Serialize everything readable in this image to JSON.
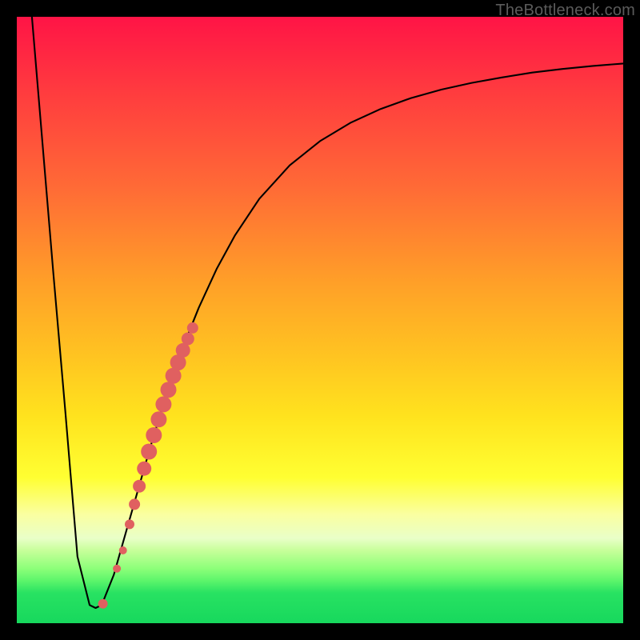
{
  "watermark": "TheBottleneck.com",
  "chart_data": {
    "type": "line",
    "title": "",
    "xlabel": "",
    "ylabel": "",
    "xlim": [
      0,
      100
    ],
    "ylim": [
      0,
      100
    ],
    "curve": {
      "name": "bottleneck-curve",
      "x": [
        2.5,
        4,
        6,
        8,
        10,
        12,
        13,
        14,
        16,
        18,
        20,
        22,
        24,
        26,
        28,
        30,
        33,
        36,
        40,
        45,
        50,
        55,
        60,
        65,
        70,
        75,
        80,
        85,
        90,
        95,
        100
      ],
      "y": [
        100,
        82,
        58,
        35,
        11,
        3,
        2.5,
        3,
        8,
        15,
        22,
        29,
        35.5,
        41.5,
        47,
        52,
        58.5,
        64,
        70,
        75.5,
        79.5,
        82.5,
        84.8,
        86.6,
        88,
        89.1,
        90,
        90.8,
        91.4,
        91.9,
        92.3
      ]
    },
    "marker_cluster": {
      "name": "highlighted-region",
      "color": "#e06060",
      "points": [
        {
          "x": 14.2,
          "y": 3.2,
          "r": 6
        },
        {
          "x": 16.5,
          "y": 9.0,
          "r": 5
        },
        {
          "x": 17.5,
          "y": 12.0,
          "r": 5
        },
        {
          "x": 18.6,
          "y": 16.3,
          "r": 6
        },
        {
          "x": 19.4,
          "y": 19.6,
          "r": 7
        },
        {
          "x": 20.2,
          "y": 22.6,
          "r": 8
        },
        {
          "x": 21.0,
          "y": 25.5,
          "r": 9
        },
        {
          "x": 21.8,
          "y": 28.3,
          "r": 10
        },
        {
          "x": 22.6,
          "y": 31.0,
          "r": 10
        },
        {
          "x": 23.4,
          "y": 33.6,
          "r": 10
        },
        {
          "x": 24.2,
          "y": 36.1,
          "r": 10
        },
        {
          "x": 25.0,
          "y": 38.5,
          "r": 10
        },
        {
          "x": 25.8,
          "y": 40.8,
          "r": 10
        },
        {
          "x": 26.6,
          "y": 43.0,
          "r": 10
        },
        {
          "x": 27.4,
          "y": 45.0,
          "r": 9
        },
        {
          "x": 28.2,
          "y": 46.9,
          "r": 8
        },
        {
          "x": 29.0,
          "y": 48.7,
          "r": 7
        }
      ]
    }
  }
}
